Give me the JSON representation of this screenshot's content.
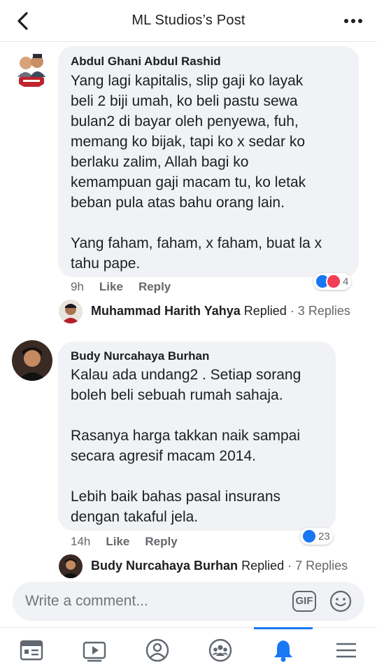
{
  "header": {
    "title": "ML Studios’s Post"
  },
  "comments": [
    {
      "author": "Abdul Ghani Abdul Rashid",
      "text": "Yang lagi kapitalis, slip gaji ko layak\nbeli 2 biji umah, ko beli pastu sewa\nbulan2 di bayar oleh penyewa, fuh,\nmemang ko bijak, tapi ko x sedar ko\nberlaku zalim, Allah bagi ko\nkemampuan gaji macam tu, ko letak\nbeban pula atas bahu orang lain.\n\nYang faham, faham, x faham, buat la x\ntahu pape.",
      "time": "9h",
      "like_label": "Like",
      "reply_label": "Reply",
      "reaction_count": "4",
      "reactions": [
        "like",
        "love"
      ],
      "reply_author": "Muhammad Harith Yahya",
      "reply_verb": "Replied",
      "reply_count": "· 3 Replies"
    },
    {
      "author": "Budy Nurcahaya Burhan",
      "text": "Kalau ada undang2 . Setiap sorang\nboleh beli sebuah rumah sahaja.\n\nRasanya harga takkan naik sampai\nsecara agresif macam 2014.\n\nLebih baik bahas pasal insurans\ndengan takaful jela.",
      "time": "14h",
      "like_label": "Like",
      "reply_label": "Reply",
      "reaction_count": "23",
      "reactions": [
        "like"
      ],
      "reply_author": "Budy Nurcahaya Burhan",
      "reply_verb": "Replied",
      "reply_count": "· 7 Replies"
    }
  ],
  "composer": {
    "placeholder": "Write a comment...",
    "gif_label": "GIF"
  },
  "bottom_nav": {
    "items": [
      "news-feed-icon",
      "watch-icon",
      "profile-icon",
      "groups-icon",
      "notifications-icon",
      "menu-icon"
    ],
    "active": "notifications-icon"
  },
  "colors": {
    "accent": "#1877f2",
    "love": "#f33e58",
    "bubble": "#f0f2f5",
    "secondary_text": "#65676b"
  }
}
